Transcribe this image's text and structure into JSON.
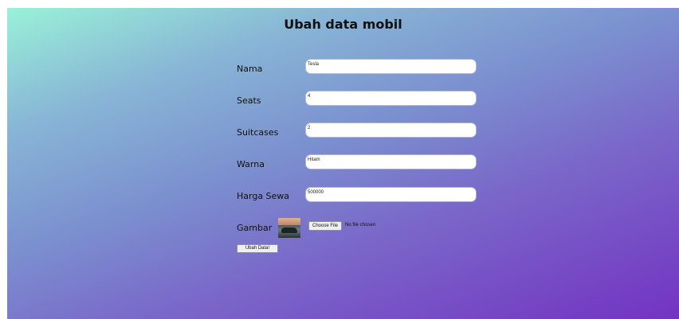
{
  "form": {
    "title": "Ubah data mobil",
    "fields": [
      {
        "label": "Nama",
        "value": "Tesla"
      },
      {
        "label": "Seats",
        "value": "4"
      },
      {
        "label": "Suitcases",
        "value": "2"
      },
      {
        "label": "Warna",
        "value": "Hitam"
      },
      {
        "label": "Harga Sewa",
        "value": "500000"
      }
    ],
    "image_label": "Gambar",
    "file_button": "Choose File",
    "file_status": "No file chosen",
    "submit": "Ubah Data!"
  }
}
